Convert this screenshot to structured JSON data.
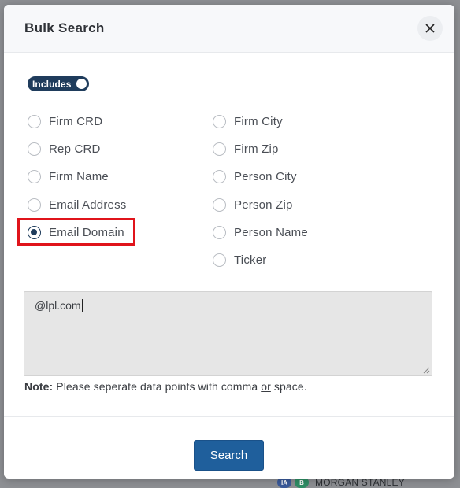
{
  "background": {
    "firm_name": "MORGAN STANLEY",
    "badge_ia": "IA",
    "badge_b": "B"
  },
  "modal": {
    "title": "Bulk Search",
    "toggle_label": "Includes",
    "options_left": [
      {
        "label": "Firm CRD",
        "checked": false
      },
      {
        "label": "Rep CRD",
        "checked": false
      },
      {
        "label": "Firm Name",
        "checked": false
      },
      {
        "label": "Email Address",
        "checked": false
      },
      {
        "label": "Email Domain",
        "checked": true
      }
    ],
    "options_right": [
      {
        "label": "Firm City",
        "checked": false
      },
      {
        "label": "Firm Zip",
        "checked": false
      },
      {
        "label": "Person City",
        "checked": false
      },
      {
        "label": "Person Zip",
        "checked": false
      },
      {
        "label": "Person Name",
        "checked": false
      },
      {
        "label": "Ticker",
        "checked": false
      }
    ],
    "textarea_value": "@lpl.com",
    "note_label": "Note:",
    "note_text_1": "Please seperate data points with comma",
    "note_or": "or",
    "note_text_2": "space.",
    "search_label": "Search"
  },
  "colors": {
    "accent": "#1f3c5c",
    "button": "#1f5f9c",
    "highlight": "#e0141b"
  }
}
